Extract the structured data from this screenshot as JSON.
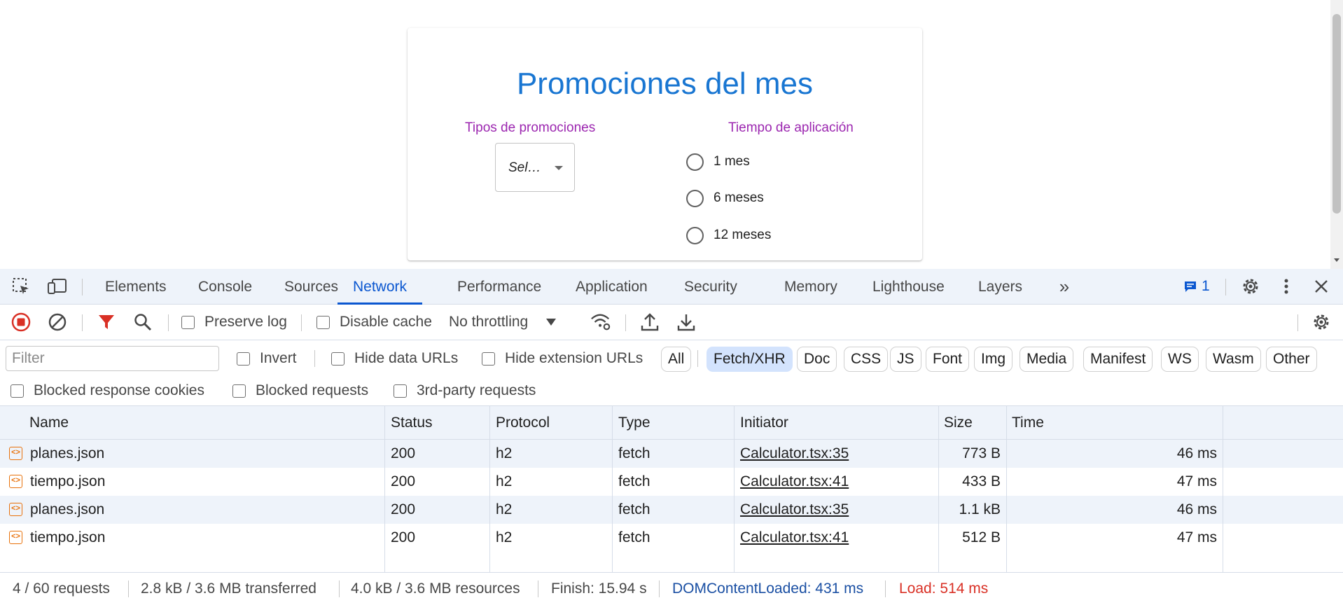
{
  "page": {
    "title": "Promociones del mes",
    "tipos_label": "Tipos de promociones",
    "tiempo_label": "Tiempo de aplicación",
    "select_value": "Sel…",
    "radio_options": [
      "1 mes",
      "6 meses",
      "12 meses"
    ]
  },
  "devtools": {
    "tabs": [
      "Elements",
      "Console",
      "Sources",
      "Network",
      "Performance",
      "Application",
      "Security",
      "Memory",
      "Lighthouse",
      "Layers"
    ],
    "active_tab": "Network",
    "issues_count": "1",
    "toolbar": {
      "preserve_log": "Preserve log",
      "disable_cache": "Disable cache",
      "throttling": "No throttling"
    },
    "filter": {
      "placeholder": "Filter",
      "invert": "Invert",
      "hide_data_urls": "Hide data URLs",
      "hide_extension_urls": "Hide extension URLs",
      "types": [
        "All",
        "Fetch/XHR",
        "Doc",
        "CSS",
        "JS",
        "Font",
        "Img",
        "Media",
        "Manifest",
        "WS",
        "Wasm",
        "Other"
      ],
      "selected_type": "Fetch/XHR",
      "blocked_response_cookies": "Blocked response cookies",
      "blocked_requests": "Blocked requests",
      "third_party": "3rd-party requests"
    },
    "columns": [
      "Name",
      "Status",
      "Protocol",
      "Type",
      "Initiator",
      "Size",
      "Time"
    ],
    "rows": [
      {
        "name": "planes.json",
        "status": "200",
        "protocol": "h2",
        "type": "fetch",
        "initiator": "Calculator.tsx:35",
        "size": "773 B",
        "time": "46 ms"
      },
      {
        "name": "tiempo.json",
        "status": "200",
        "protocol": "h2",
        "type": "fetch",
        "initiator": "Calculator.tsx:41",
        "size": "433 B",
        "time": "47 ms"
      },
      {
        "name": "planes.json",
        "status": "200",
        "protocol": "h2",
        "type": "fetch",
        "initiator": "Calculator.tsx:35",
        "size": "1.1 kB",
        "time": "46 ms"
      },
      {
        "name": "tiempo.json",
        "status": "200",
        "protocol": "h2",
        "type": "fetch",
        "initiator": "Calculator.tsx:41",
        "size": "512 B",
        "time": "47 ms"
      }
    ],
    "status": {
      "requests": "4 / 60 requests",
      "transferred": "2.8 kB / 3.6 MB transferred",
      "resources": "4.0 kB / 3.6 MB resources",
      "finish": "Finish: 15.94 s",
      "dom_content_loaded": "DOMContentLoaded: 431 ms",
      "load": "Load: 514 ms"
    },
    "colors": {
      "accent": "#0b57d0",
      "dcl": "#1a4fa3",
      "load": "#d93025",
      "record": "#d93025"
    }
  }
}
